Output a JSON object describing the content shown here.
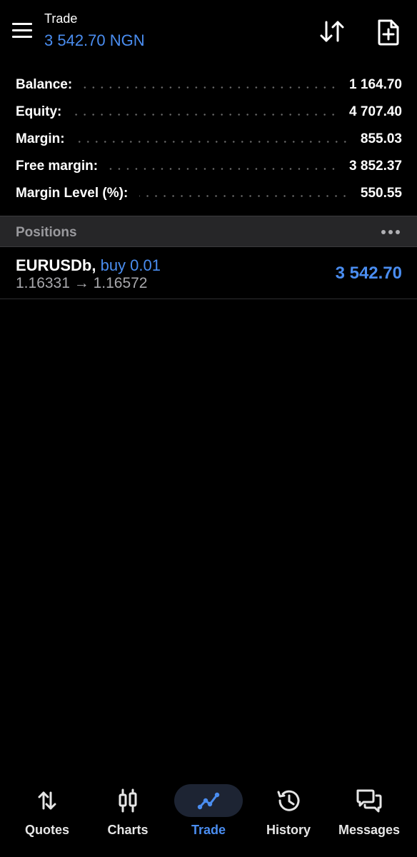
{
  "header": {
    "title": "Trade",
    "subtitle": "3 542.70 NGN"
  },
  "summary": [
    {
      "label": "Balance:",
      "value": "1 164.70"
    },
    {
      "label": "Equity:",
      "value": "4 707.40"
    },
    {
      "label": "Margin:",
      "value": "855.03"
    },
    {
      "label": "Free margin:",
      "value": "3 852.37"
    },
    {
      "label": "Margin Level (%):",
      "value": "550.55"
    }
  ],
  "positions": {
    "title": "Positions",
    "items": [
      {
        "symbol": "EURUSDb,",
        "type": "buy 0.01",
        "prices": "1.16331 → 1.16572",
        "profit": "3 542.70"
      }
    ]
  },
  "nav": {
    "items": [
      {
        "label": "Quotes",
        "icon": "quotes-icon"
      },
      {
        "label": "Charts",
        "icon": "charts-icon"
      },
      {
        "label": "Trade",
        "icon": "trade-icon",
        "active": true
      },
      {
        "label": "History",
        "icon": "history-icon"
      },
      {
        "label": "Messages",
        "icon": "messages-icon"
      }
    ]
  },
  "colors": {
    "accent": "#4a8df0",
    "background": "#000000",
    "section_header": "#262628",
    "active_pill": "#1d2433"
  }
}
